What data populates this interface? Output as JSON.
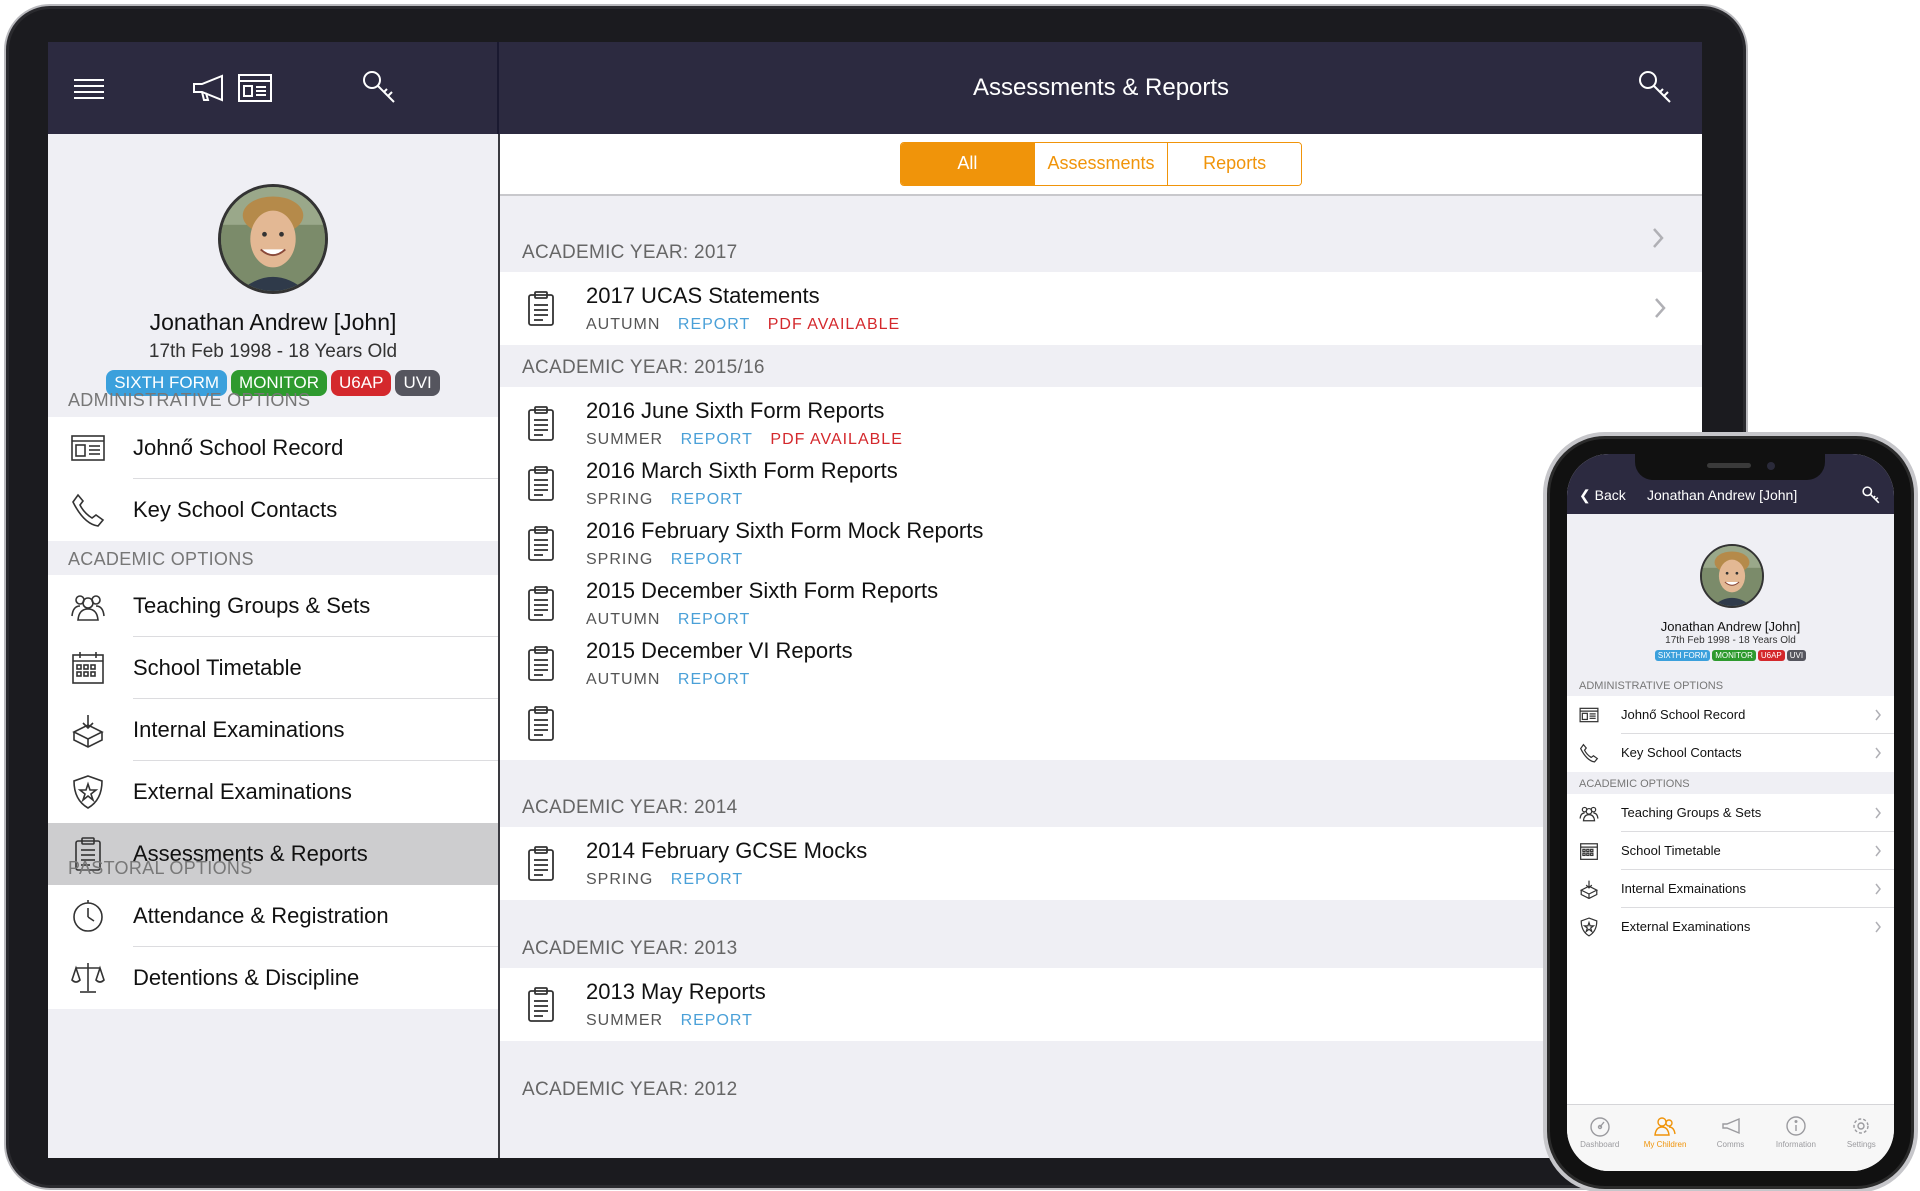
{
  "tablet": {
    "header": {
      "title": "Assessments & Reports"
    },
    "profile": {
      "name": "Jonathan Andrew [John]",
      "dob": "17th Feb 1998 - 18 Years Old",
      "badges": [
        {
          "label": "SIXTH FORM",
          "color": "#3ba0dc"
        },
        {
          "label": "MONITOR",
          "color": "#2e9a2e"
        },
        {
          "label": "U6AP",
          "color": "#d4282c"
        },
        {
          "label": "UVI",
          "color": "#55555e"
        }
      ]
    },
    "sidebar": {
      "admin_heading": "ADMINISTRATIVE OPTIONS",
      "academic_heading": "ACADEMIC OPTIONS",
      "pastoral_heading": "PASTORAL OPTIONS",
      "admin_items": [
        {
          "label": "Johnő School Record",
          "icon": "id-card-icon"
        },
        {
          "label": "Key School Contacts",
          "icon": "phone-icon"
        }
      ],
      "academic_items": [
        {
          "label": "Teaching Groups & Sets",
          "icon": "group-icon"
        },
        {
          "label": "School Timetable",
          "icon": "calendar-icon"
        },
        {
          "label": "Internal Examinations",
          "icon": "box-icon"
        },
        {
          "label": "External Examinations",
          "icon": "shield-star-icon"
        },
        {
          "label": "Assessments & Reports",
          "icon": "clipboard-icon"
        }
      ],
      "pastoral_items": [
        {
          "label": "Attendance & Registration",
          "icon": "clock-icon"
        },
        {
          "label": "Detentions & Discipline",
          "icon": "scales-icon"
        }
      ]
    },
    "filter": {
      "segments": [
        "All",
        "Assessments",
        "Reports"
      ],
      "selected": "All"
    },
    "years": [
      {
        "heading": "ACADEMIC YEAR: 2017",
        "items": [
          {
            "title": "2017 UCAS Statements",
            "term": "AUTUMN",
            "type": "REPORT",
            "pdf": "PDF AVAILABLE"
          }
        ]
      },
      {
        "heading": "ACADEMIC YEAR: 2015/16",
        "items": [
          {
            "title": "2016 June Sixth Form Reports",
            "term": "SUMMER",
            "type": "REPORT",
            "pdf": "PDF AVAILABLE"
          },
          {
            "title": "2016 March Sixth Form Reports",
            "term": "SPRING",
            "type": "REPORT"
          },
          {
            "title": "2016 February Sixth Form Mock Reports",
            "term": "SPRING",
            "type": "REPORT"
          },
          {
            "title": "2015 December Sixth Form Reports",
            "term": "AUTUMN",
            "type": "REPORT"
          },
          {
            "title": "2015 December VI Reports",
            "term": "AUTUMN",
            "type": "REPORT"
          }
        ]
      },
      {
        "heading": "ACADEMIC YEAR: 2014",
        "items": [
          {
            "title": "2014 February GCSE Mocks",
            "term": "SPRING",
            "type": "REPORT"
          }
        ]
      },
      {
        "heading": "ACADEMIC YEAR: 2013",
        "items": [
          {
            "title": "2013 May Reports",
            "term": "SUMMER",
            "type": "REPORT"
          }
        ]
      },
      {
        "heading": "ACADEMIC YEAR: 2012",
        "items": []
      }
    ]
  },
  "phone": {
    "back_label": "Back",
    "title": "Jonathan Andrew [John]",
    "profile": {
      "name": "Jonathan Andrew [John]",
      "dob": "17th Feb 1998 - 18 Years Old",
      "badges": [
        {
          "label": "SIXTH FORM",
          "color": "#3ba0dc"
        },
        {
          "label": "MONITOR",
          "color": "#2e9a2e"
        },
        {
          "label": "U6AP",
          "color": "#d4282c"
        },
        {
          "label": "UVI",
          "color": "#55555e"
        }
      ]
    },
    "admin_heading": "ADMINISTRATIVE OPTIONS",
    "academic_heading": "ACADEMIC OPTIONS",
    "admin_items": [
      {
        "label": "Johnő School Record",
        "icon": "id-card-icon"
      },
      {
        "label": "Key School Contacts",
        "icon": "phone-icon"
      }
    ],
    "academic_items": [
      {
        "label": "Teaching Groups & Sets",
        "icon": "group-icon"
      },
      {
        "label": "School Timetable",
        "icon": "calendar-icon"
      },
      {
        "label": "Internal Exmainations",
        "icon": "box-icon"
      },
      {
        "label": "External Examinations",
        "icon": "shield-star-icon"
      }
    ],
    "tabs": [
      {
        "label": "Dashboard",
        "icon": "dashboard-icon"
      },
      {
        "label": "My Children",
        "icon": "children-icon",
        "active": true
      },
      {
        "label": "Comms",
        "icon": "megaphone-icon"
      },
      {
        "label": "Information",
        "icon": "info-icon"
      },
      {
        "label": "Settings",
        "icon": "gear-icon"
      }
    ]
  },
  "colors": {
    "header": "#2c2a40",
    "accent": "#f0940a",
    "report_blue": "#4aa0d8",
    "pdf_red": "#d4282c"
  }
}
